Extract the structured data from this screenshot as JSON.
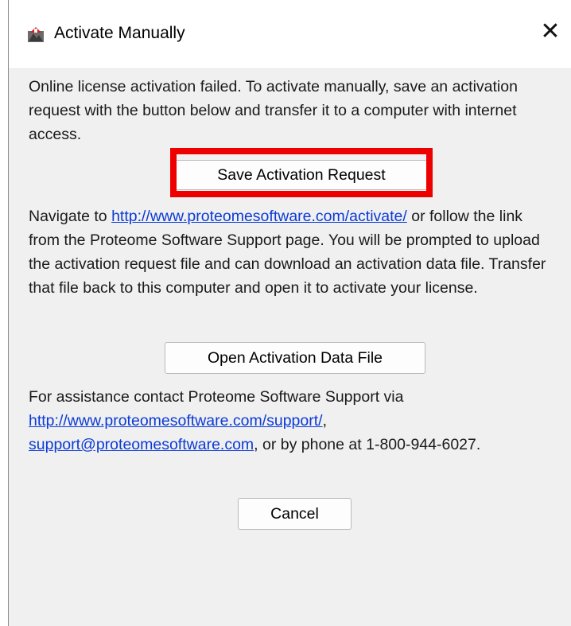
{
  "dialog": {
    "title": "Activate Manually",
    "close_symbol": "✕",
    "icon_name": "app-icon"
  },
  "intro_text": "Online license activation failed. To activate manually, save an activation request with the button below and transfer it to a computer with internet access.",
  "save_button_label": "Save Activation Request",
  "navigate": {
    "prefix": "Navigate to ",
    "link": "http://www.proteomesoftware.com/activate/",
    "suffix": " or follow the link from the Proteome Software Support page. You will be prompted to upload the activation request file and can download an activation data file. Transfer that file back to this computer and open it to activate your license."
  },
  "open_button_label": "Open Activation Data File",
  "assistance": {
    "prefix": "For assistance contact Proteome Software Support via ",
    "support_link": "http://www.proteomesoftware.com/support/",
    "comma": ", ",
    "email_link": "support@proteomesoftware.com",
    "suffix": ", or by phone at 1-800-944-6027."
  },
  "cancel_button_label": "Cancel",
  "colors": {
    "link": "#0b3bd6",
    "highlight": "#ee0000",
    "dialog_bg": "#f0f0f0"
  }
}
